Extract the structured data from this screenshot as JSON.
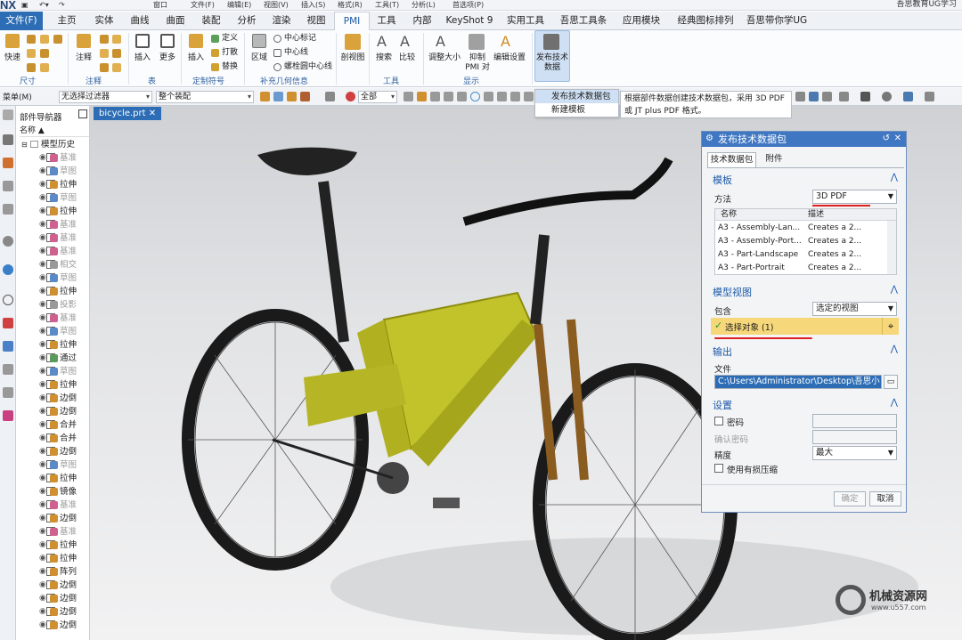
{
  "app": {
    "logo": "NX",
    "title": "吾思教育UG学习",
    "menus": [
      "窗口",
      "文件(F)",
      "编辑(E)",
      "视图(V)",
      "插入(S)",
      "格式(R)",
      "工具(T)",
      "分析(L)",
      "首选项(P)"
    ]
  },
  "tabs": [
    "文件(F)",
    "主页",
    "实体",
    "曲线",
    "曲面",
    "装配",
    "分析",
    "渲染",
    "视图",
    "PMI",
    "工具",
    "内部",
    "KeyShot 9",
    "实用工具",
    "吾思工具条",
    "应用模块",
    "经典图标排列",
    "吾思带你学UG"
  ],
  "ribbon": {
    "buttons": [
      "快速",
      "注释",
      "插入",
      "更多",
      "插入",
      "区域",
      "剖视图",
      "搜索",
      "比较",
      "调整大小",
      "抑制PMI 对",
      "编辑设置",
      "发布技术数据"
    ],
    "small": [
      "定义",
      "打散",
      "替换",
      "中心标记",
      "中心线",
      "螺栓圆中心线"
    ],
    "groups": [
      "尺寸",
      "注释",
      "表",
      "定制符号",
      "补充几何信息",
      "工具",
      "显示"
    ]
  },
  "toolbar": {
    "menu": "菜单(M)",
    "filter": "无选择过滤器",
    "assembly": "整个装配",
    "scope": "全部"
  },
  "dropdown_menu": {
    "items": [
      "发布技术数据包",
      "新建模板"
    ]
  },
  "tooltip": "根据部件数据创建技术数据包，采用 3D PDF 或 JT plus PDF 格式。",
  "doc_tab": "bicycle.prt",
  "navigator": {
    "title": "部件导航器",
    "col": "名称",
    "root": "模型历史",
    "rows": [
      "基准",
      "草图",
      "拉伸",
      "草图",
      "拉伸",
      "基准",
      "基准",
      "基准",
      "相交",
      "草图",
      "拉伸",
      "投影",
      "基准",
      "草图",
      "拉伸",
      "通过",
      "草图",
      "拉伸",
      "边倒",
      "边倒",
      "合并",
      "合并",
      "边倒",
      "草图",
      "拉伸",
      "镜像",
      "基准",
      "边倒",
      "基准",
      "拉伸",
      "拉伸",
      "阵列",
      "边倒",
      "边倒",
      "边倒",
      "边倒"
    ]
  },
  "dialog": {
    "title": "发布技术数据包",
    "tabs": [
      "技术数据包",
      "附件"
    ],
    "template": {
      "header": "模板",
      "method_label": "方法",
      "method": "3D PDF",
      "cols": [
        "名称",
        "描述"
      ],
      "rows": [
        [
          "A3 - Assembly-Lan...",
          "Creates a 2..."
        ],
        [
          "A3 - Assembly-Port...",
          "Creates a 2..."
        ],
        [
          "A3 - Part-Landscape",
          "Creates a 2..."
        ],
        [
          "A3 - Part-Portrait",
          "Creates a 2..."
        ]
      ]
    },
    "model": {
      "header": "模型视图",
      "include_label": "包含",
      "include": "选定的视图",
      "select": "选择对象 (1)"
    },
    "output": {
      "header": "输出",
      "file_label": "文件",
      "file": "C:\\Users\\Administrator\\Desktop\\吾思小"
    },
    "settings": {
      "header": "设置",
      "password": "密码",
      "confirm": "确认密码",
      "precision_label": "精度",
      "precision": "最大",
      "lossy": "使用有损压缩"
    },
    "ok": "确定",
    "cancel": "取消"
  },
  "watermark": {
    "name": "机械资源网",
    "url": "www.u557.com"
  }
}
